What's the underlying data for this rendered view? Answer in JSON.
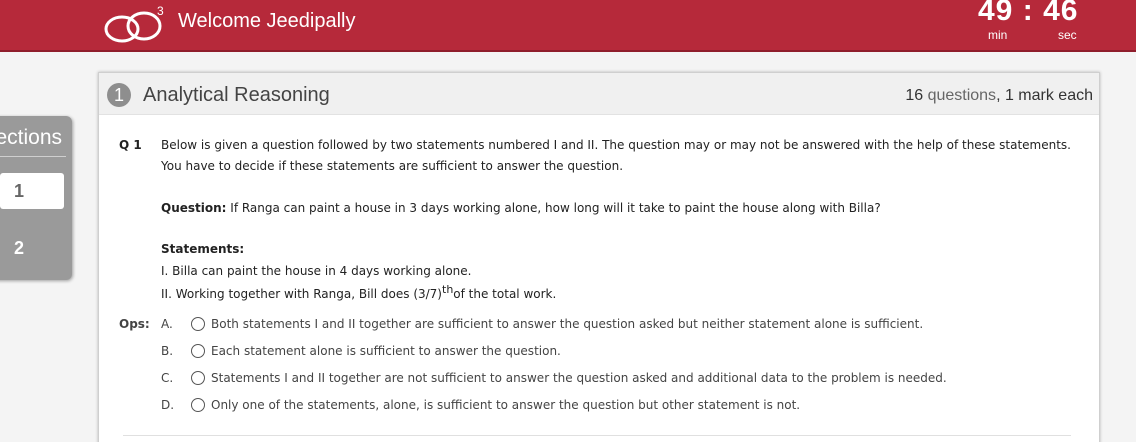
{
  "header": {
    "welcome_text": "Welcome Jeedipally",
    "logo_mark": "3",
    "timer": {
      "minutes": "49",
      "separator": ":",
      "seconds": "46",
      "min_label": "min",
      "sec_label": "sec"
    },
    "brand_color": "#b6293a"
  },
  "sections_panel": {
    "title": "Sections",
    "items": [
      {
        "label": "1",
        "active": true
      },
      {
        "label": "2",
        "active": false
      }
    ]
  },
  "section": {
    "number": "1",
    "title": "Analytical Reasoning",
    "question_count": "16",
    "questions_word": "questions",
    "mark_info": ", 1 mark each"
  },
  "question": {
    "number": "Q 1",
    "intro": "Below is given a question followed by two statements numbered I and II. The question may or may not be answered with the help of these statements. You have to decide if these statements are sufficient to answer the question.",
    "question_label": "Question:",
    "question_text": " If Ranga can paint a house in 3 days working alone, how long will it take to paint the house along with Billa?",
    "statements_label": "Statements:",
    "statement_1": "I. Billa can paint the house in 4 days working alone.",
    "statement_2_prefix": "II. Working together with Ranga, Bill does (3/7)",
    "statement_2_sup": "th",
    "statement_2_suffix": "of the total work."
  },
  "options": {
    "label": "Ops:",
    "items": [
      {
        "letter": "A.",
        "text": "Both statements I and II together are sufficient to answer the question asked but neither statement alone is sufficient."
      },
      {
        "letter": "B.",
        "text": "Each statement alone is sufficient to answer the question."
      },
      {
        "letter": "C.",
        "text": "Statements I and II together are not sufficient to answer the question asked and additional data to the problem is needed."
      },
      {
        "letter": "D.",
        "text": "Only one of the statements, alone, is sufficient to answer the question but other statement is not."
      }
    ]
  }
}
